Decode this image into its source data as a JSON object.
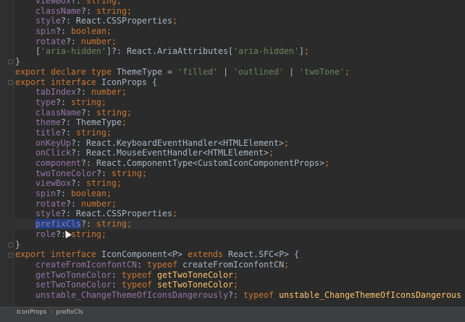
{
  "editor": {
    "lines": [
      [
        {
          "t": "    viewBox",
          "c": "prop"
        },
        {
          "t": "?: ",
          "c": "plain"
        },
        {
          "t": "string",
          "c": "kw"
        },
        {
          "t": ";",
          "c": "punct"
        }
      ],
      [
        {
          "t": "    className",
          "c": "prop"
        },
        {
          "t": "?: ",
          "c": "plain"
        },
        {
          "t": "string",
          "c": "kw"
        },
        {
          "t": ";",
          "c": "punct"
        }
      ],
      [
        {
          "t": "    style",
          "c": "prop"
        },
        {
          "t": "?: React.CSSProperties",
          "c": "plain"
        },
        {
          "t": ";",
          "c": "punct"
        }
      ],
      [
        {
          "t": "    spin",
          "c": "prop"
        },
        {
          "t": "?: ",
          "c": "plain"
        },
        {
          "t": "boolean",
          "c": "kw"
        },
        {
          "t": ";",
          "c": "punct"
        }
      ],
      [
        {
          "t": "    rotate",
          "c": "prop"
        },
        {
          "t": "?: ",
          "c": "plain"
        },
        {
          "t": "number",
          "c": "kw"
        },
        {
          "t": ";",
          "c": "punct"
        }
      ],
      [
        {
          "t": "    [",
          "c": "plain"
        },
        {
          "t": "'aria-hidden'",
          "c": "str"
        },
        {
          "t": "]?: React.AriaAttributes[",
          "c": "plain"
        },
        {
          "t": "'aria-hidden'",
          "c": "str"
        },
        {
          "t": "]",
          "c": "plain"
        },
        {
          "t": ";",
          "c": "punct"
        }
      ],
      [
        {
          "t": "}",
          "c": "plain"
        }
      ],
      [
        {
          "t": "export declare type ",
          "c": "kw"
        },
        {
          "t": "ThemeType = ",
          "c": "plain"
        },
        {
          "t": "'filled'",
          "c": "str"
        },
        {
          "t": " | ",
          "c": "plain"
        },
        {
          "t": "'outlined'",
          "c": "str"
        },
        {
          "t": " | ",
          "c": "plain"
        },
        {
          "t": "'twoTone'",
          "c": "str"
        },
        {
          "t": ";",
          "c": "punct"
        }
      ],
      [
        {
          "t": "export interface ",
          "c": "kw"
        },
        {
          "t": "IconProps {",
          "c": "plain"
        }
      ],
      [
        {
          "t": "    tabIndex",
          "c": "prop"
        },
        {
          "t": "?: ",
          "c": "plain"
        },
        {
          "t": "number",
          "c": "kw"
        },
        {
          "t": ";",
          "c": "punct"
        }
      ],
      [
        {
          "t": "    type",
          "c": "prop"
        },
        {
          "t": "?: ",
          "c": "plain"
        },
        {
          "t": "string",
          "c": "kw"
        },
        {
          "t": ";",
          "c": "punct"
        }
      ],
      [
        {
          "t": "    className",
          "c": "prop"
        },
        {
          "t": "?: ",
          "c": "plain"
        },
        {
          "t": "string",
          "c": "kw"
        },
        {
          "t": ";",
          "c": "punct"
        }
      ],
      [
        {
          "t": "    theme",
          "c": "prop"
        },
        {
          "t": "?: ThemeType",
          "c": "plain"
        },
        {
          "t": ";",
          "c": "punct"
        }
      ],
      [
        {
          "t": "    title",
          "c": "prop"
        },
        {
          "t": "?: ",
          "c": "plain"
        },
        {
          "t": "string",
          "c": "kw"
        },
        {
          "t": ";",
          "c": "punct"
        }
      ],
      [
        {
          "t": "    onKeyUp",
          "c": "prop"
        },
        {
          "t": "?: React.KeyboardEventHandler<HTMLElement>",
          "c": "plain"
        },
        {
          "t": ";",
          "c": "punct"
        }
      ],
      [
        {
          "t": "    onClick",
          "c": "prop"
        },
        {
          "t": "?: React.MouseEventHandler<HTMLElement>",
          "c": "plain"
        },
        {
          "t": ";",
          "c": "punct"
        }
      ],
      [
        {
          "t": "    component",
          "c": "prop"
        },
        {
          "t": "?: React.ComponentType<CustomIconComponentProps>",
          "c": "plain"
        },
        {
          "t": ";",
          "c": "punct"
        }
      ],
      [
        {
          "t": "    twoToneColor",
          "c": "prop"
        },
        {
          "t": "?: ",
          "c": "plain"
        },
        {
          "t": "string",
          "c": "kw"
        },
        {
          "t": ";",
          "c": "punct"
        }
      ],
      [
        {
          "t": "    viewBox",
          "c": "prop"
        },
        {
          "t": "?: ",
          "c": "plain"
        },
        {
          "t": "string",
          "c": "kw"
        },
        {
          "t": ";",
          "c": "punct"
        }
      ],
      [
        {
          "t": "    spin",
          "c": "prop"
        },
        {
          "t": "?: ",
          "c": "plain"
        },
        {
          "t": "boolean",
          "c": "kw"
        },
        {
          "t": ";",
          "c": "punct"
        }
      ],
      [
        {
          "t": "    rotate",
          "c": "prop"
        },
        {
          "t": "?: ",
          "c": "plain"
        },
        {
          "t": "number",
          "c": "kw"
        },
        {
          "t": ";",
          "c": "punct"
        }
      ],
      [
        {
          "t": "    style",
          "c": "prop"
        },
        {
          "t": "?: React.CSSProperties",
          "c": "plain"
        },
        {
          "t": ";",
          "c": "punct"
        }
      ],
      [
        {
          "t": "    ",
          "c": "plain"
        },
        {
          "t": "prefixCls",
          "c": "sel"
        },
        {
          "t": "?: ",
          "c": "plain"
        },
        {
          "t": "string",
          "c": "kw"
        },
        {
          "t": ";",
          "c": "punct"
        }
      ],
      [
        {
          "t": "    role",
          "c": "prop"
        },
        {
          "t": "?: ",
          "c": "plain"
        },
        {
          "t": "string",
          "c": "kw"
        },
        {
          "t": ";",
          "c": "punct"
        }
      ],
      [
        {
          "t": "}",
          "c": "plain"
        }
      ],
      [
        {
          "t": "export interface ",
          "c": "kw"
        },
        {
          "t": "IconComponent<P> ",
          "c": "plain"
        },
        {
          "t": "extends ",
          "c": "kw"
        },
        {
          "t": "React.SFC<P> {",
          "c": "plain"
        }
      ],
      [
        {
          "t": "    createFromIconfontCN",
          "c": "prop"
        },
        {
          "t": ": ",
          "c": "plain"
        },
        {
          "t": "typeof ",
          "c": "kw"
        },
        {
          "t": "createFromIconfontCN",
          "c": "plain"
        },
        {
          "t": ";",
          "c": "punct"
        }
      ],
      [
        {
          "t": "    getTwoToneColor",
          "c": "prop"
        },
        {
          "t": ": ",
          "c": "plain"
        },
        {
          "t": "typeof ",
          "c": "kw"
        },
        {
          "t": "getTwoToneColor",
          "c": "yel"
        },
        {
          "t": ";",
          "c": "punct"
        }
      ],
      [
        {
          "t": "    setTwoToneColor",
          "c": "prop"
        },
        {
          "t": ": ",
          "c": "plain"
        },
        {
          "t": "typeof ",
          "c": "kw"
        },
        {
          "t": "setTwoToneColor",
          "c": "yel"
        },
        {
          "t": ";",
          "c": "punct"
        }
      ],
      [
        {
          "t": "    unstable_ChangeThemeOfIconsDangerously",
          "c": "prop"
        },
        {
          "t": "?: ",
          "c": "plain"
        },
        {
          "t": "typeof ",
          "c": "kw"
        },
        {
          "t": "unstable_ChangeThemeOfIconsDangerous",
          "c": "yel"
        }
      ]
    ],
    "current_line": 22
  },
  "breadcrumb": {
    "items": [
      "IconProps",
      "prefixCls"
    ]
  },
  "colors": {
    "background": "#2b2b2b",
    "keyword": "#cc7832",
    "property": "#9876aa",
    "string": "#6a8759",
    "function": "#ffc66d",
    "text": "#a9b7c6",
    "selection": "#214283"
  }
}
